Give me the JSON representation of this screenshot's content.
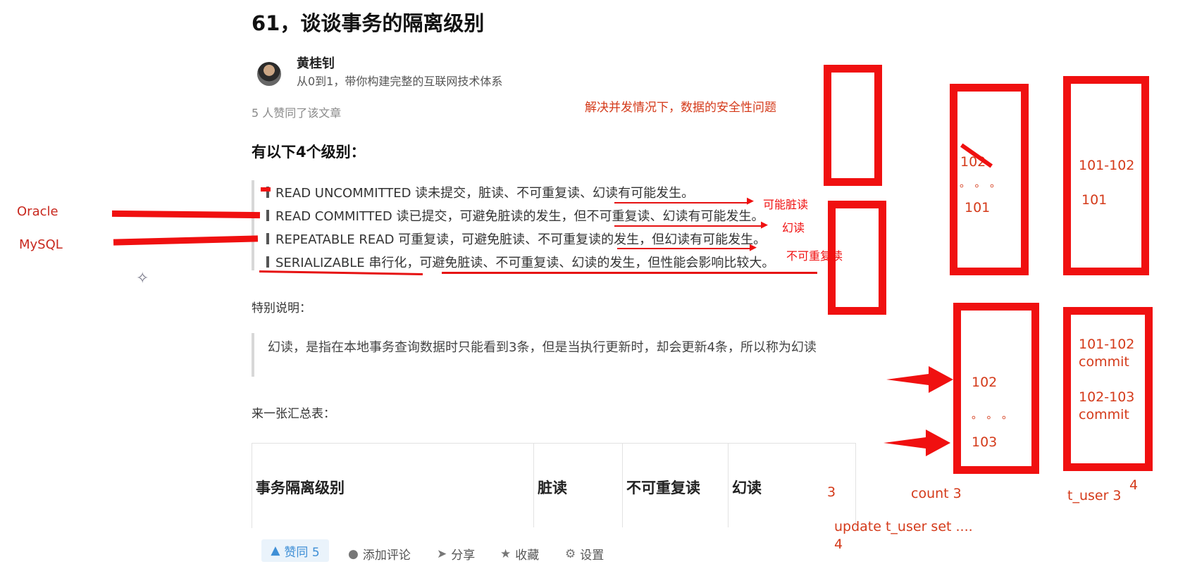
{
  "article": {
    "title": "61，谈谈事务的隔离级别",
    "author_name": "黄桂钊",
    "author_bio": "从0到1，带你构建完整的互联网技术体系",
    "likes_line": "5 人赞同了该文章",
    "levels_heading": "有以下4个级别：",
    "isolation_levels": [
      "READ UNCOMMITTED 读未提交，脏读、不可重复读、幻读有可能发生。",
      "READ COMMITTED 读已提交，可避免脏读的发生，但不可重复读、幻读有可能发生。",
      "REPEATABLE READ 可重复读，可避免脏读、不可重复读的发生，但幻读有可能发生。",
      "SERIALIZABLE 串行化，可避免脏读、不可重复读、幻读的发生，但性能会影响比较大。"
    ],
    "note_title": "特别说明：",
    "note_text": "幻读，是指在本地事务查询数据时只能看到3条，但是当执行更新时，却会更新4条，所以称为幻读",
    "summary_title": "来一张汇总表：",
    "table_headers": [
      "事务隔离级别",
      "脏读",
      "不可重复读",
      "幻读"
    ]
  },
  "actions": {
    "like": "赞同 5",
    "comment": "添加评论",
    "share": "分享",
    "favorite": "收藏",
    "settings": "设置"
  },
  "annotations": {
    "oracle": "Oracle",
    "mysql": "MySQL",
    "concurrency_note": "解决并发情况下，数据的安全性问题",
    "dirty_read": "可能脏读",
    "phantom_read": "幻读",
    "non_repeatable_read": "不可重复读",
    "box1_top": "102",
    "box1_dots": "。。。",
    "box1_bottom": "101",
    "box2_top": "101-102",
    "box2_bottom": "101",
    "box3_top": "102",
    "box3_dots": "。。。",
    "box3_bottom": "103",
    "box4_line1": "101-102",
    "box4_line2": "commit",
    "box4_line3": "102-103",
    "box4_line4": "commit",
    "count_label": "count 3",
    "tuser_label": "t_user 3",
    "num_three": "3",
    "num_four_a": "4",
    "update_sql": "update t_user set ....",
    "num_four_b": "4"
  },
  "colors": {
    "annotation_red": "#f01010",
    "zhihu_blue": "#3f8fd6"
  },
  "icons": [
    "like-triangle-icon",
    "comment-bubble-icon",
    "share-plane-icon",
    "star-icon",
    "gear-icon",
    "sparkle-cursor-icon"
  ]
}
